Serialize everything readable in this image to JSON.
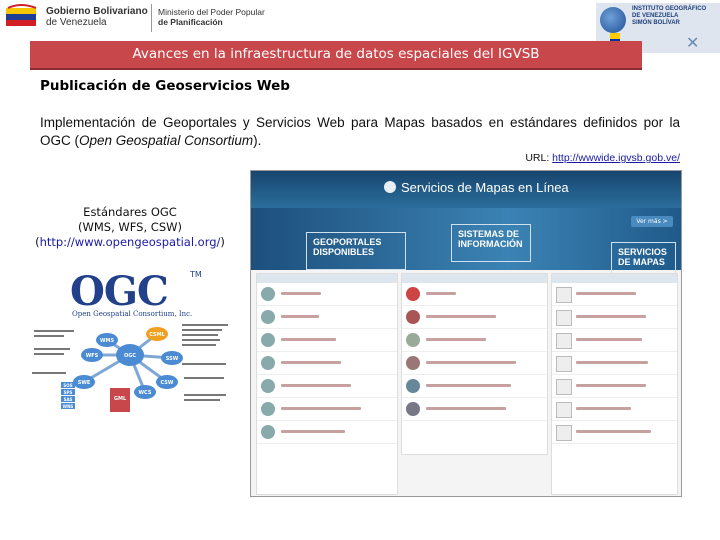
{
  "header": {
    "gov_line1": "Gobierno Bolivariano",
    "gov_line2": "de Venezuela",
    "ministry_line1": "Ministerio del Poder Popular",
    "ministry_line2": "de Planificación",
    "igvsb_line1": "INSTITUTO GEOGRÁFICO",
    "igvsb_line2": "DE VENEZUELA",
    "igvsb_line3": "SIMÓN BOLÍVAR"
  },
  "banner_title": "Avances en la infraestructura de datos espaciales del IGVSB",
  "section_title": "Publicación de Geoservicios Web",
  "body": {
    "text_before_italic": "Implementación de Geoportales y Servicios Web para Mapas basados en estándares definidos por la OGC (",
    "italic": "Open Geospatial Consortium",
    "text_after_italic": ").",
    "url_label": "URL: ",
    "url": "http://wwwide.igvsb.gob.ve/"
  },
  "standards": {
    "line1": "Estándares OGC",
    "line2": "(WMS, WFS, CSW)",
    "line3_prefix": "(",
    "line3_link": "http://www.opengeospatial.org/",
    "line3_suffix": ")"
  },
  "ogc_logo": {
    "word": "OGC",
    "tm": "TM",
    "subtitle": "Open Geospatial Consortium, Inc."
  },
  "diagram": {
    "nodes": [
      "WMS",
      "CSML",
      "WFS",
      "OGC",
      "SSW",
      "SWE",
      "CSW",
      "WCS",
      "GML",
      "SOS",
      "SPS",
      "SAS",
      "WNS"
    ]
  },
  "website": {
    "title": "Servicios de Mapas en Línea",
    "tile1": "GEOPORTALES DISPONIBLES",
    "tile2": "SISTEMAS DE INFORMACIÓN",
    "tile3": "SERVICIOS DE MAPAS",
    "button": "Ver más >"
  },
  "colors": {
    "banner": "#c8474b",
    "link": "#1a1aa6",
    "ogc_blue": "#22418a"
  }
}
